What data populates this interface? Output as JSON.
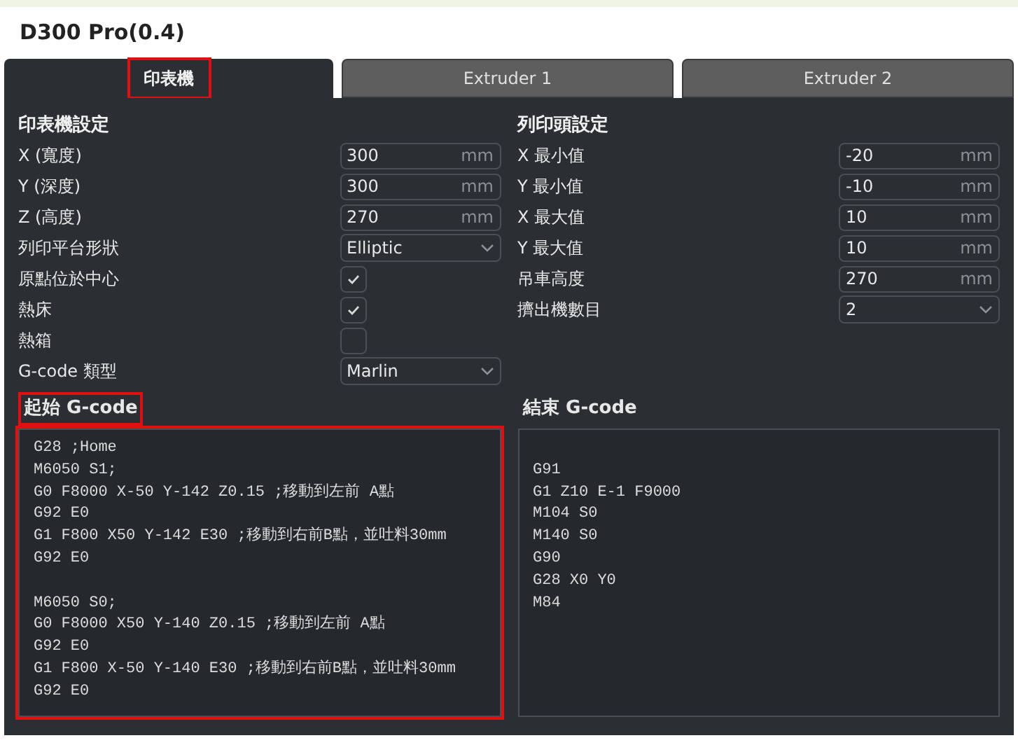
{
  "title": "D300 Pro(0.4)",
  "tabs": [
    {
      "label": "印表機",
      "selected": true,
      "highlighted": true
    },
    {
      "label": "Extruder 1",
      "selected": false,
      "highlighted": false
    },
    {
      "label": "Extruder 2",
      "selected": false,
      "highlighted": false
    }
  ],
  "printer_settings": {
    "heading": "印表機設定",
    "rows": [
      {
        "kind": "number",
        "label": "X (寬度)",
        "value": "300",
        "unit": "mm"
      },
      {
        "kind": "number",
        "label": "Y (深度)",
        "value": "300",
        "unit": "mm"
      },
      {
        "kind": "number",
        "label": "Z (高度)",
        "value": "270",
        "unit": "mm"
      },
      {
        "kind": "select",
        "label": "列印平台形狀",
        "value": "Elliptic"
      },
      {
        "kind": "checkbox",
        "label": "原點位於中心",
        "checked": true
      },
      {
        "kind": "checkbox",
        "label": "熱床",
        "checked": true
      },
      {
        "kind": "checkbox",
        "label": "熱箱",
        "checked": false
      },
      {
        "kind": "select",
        "label": "G-code 類型",
        "value": "Marlin"
      }
    ]
  },
  "printhead_settings": {
    "heading": "列印頭設定",
    "rows": [
      {
        "kind": "number",
        "label": "X 最小值",
        "value": "-20",
        "unit": "mm"
      },
      {
        "kind": "number",
        "label": "Y 最小值",
        "value": "-10",
        "unit": "mm"
      },
      {
        "kind": "number",
        "label": "X 最大值",
        "value": "10",
        "unit": "mm"
      },
      {
        "kind": "number",
        "label": "Y 最大值",
        "value": "10",
        "unit": "mm"
      },
      {
        "kind": "number",
        "label": "吊車高度",
        "value": "270",
        "unit": "mm"
      },
      {
        "kind": "select",
        "label": "擠出機數目",
        "value": "2"
      }
    ]
  },
  "start_gcode": {
    "heading": "起始 G-code",
    "highlighted": true,
    "lines": [
      {
        "text": "G28 ;Home",
        "blank_before": false
      },
      {
        "text": "M6050 S1;",
        "blank_before": false
      },
      {
        "text": "G0 F8000 X-50 Y-142 Z0.15 ;移動到左前 A點",
        "blank_before": false
      },
      {
        "text": "G92 E0",
        "blank_before": false
      },
      {
        "text": "G1 F800 X50 Y-142 E30 ;移動到右前B點，並吐料30mm",
        "blank_before": false
      },
      {
        "text": "G92 E0",
        "blank_before": false
      },
      {
        "text": "M6050 S0;",
        "blank_before": true
      },
      {
        "text": "G0 F8000 X50 Y-140 Z0.15 ;移動到左前 A點",
        "blank_before": false
      },
      {
        "text": "G92 E0",
        "blank_before": false
      },
      {
        "text": "G1 F800 X-50 Y-140 E30 ;移動到右前B點，並吐料30mm",
        "blank_before": false
      },
      {
        "text": "G92 E0",
        "blank_before": false
      }
    ]
  },
  "end_gcode": {
    "heading": "結束 G-code",
    "highlighted": false,
    "lines": [
      {
        "text": "G91",
        "blank_before": true
      },
      {
        "text": "G1 Z10 E-1 F9000",
        "blank_before": false
      },
      {
        "text": "M104 S0",
        "blank_before": false
      },
      {
        "text": "M140 S0",
        "blank_before": false
      },
      {
        "text": "G90",
        "blank_before": false
      },
      {
        "text": "G28 X0 Y0",
        "blank_before": false
      },
      {
        "text": "M84",
        "blank_before": false
      }
    ]
  }
}
